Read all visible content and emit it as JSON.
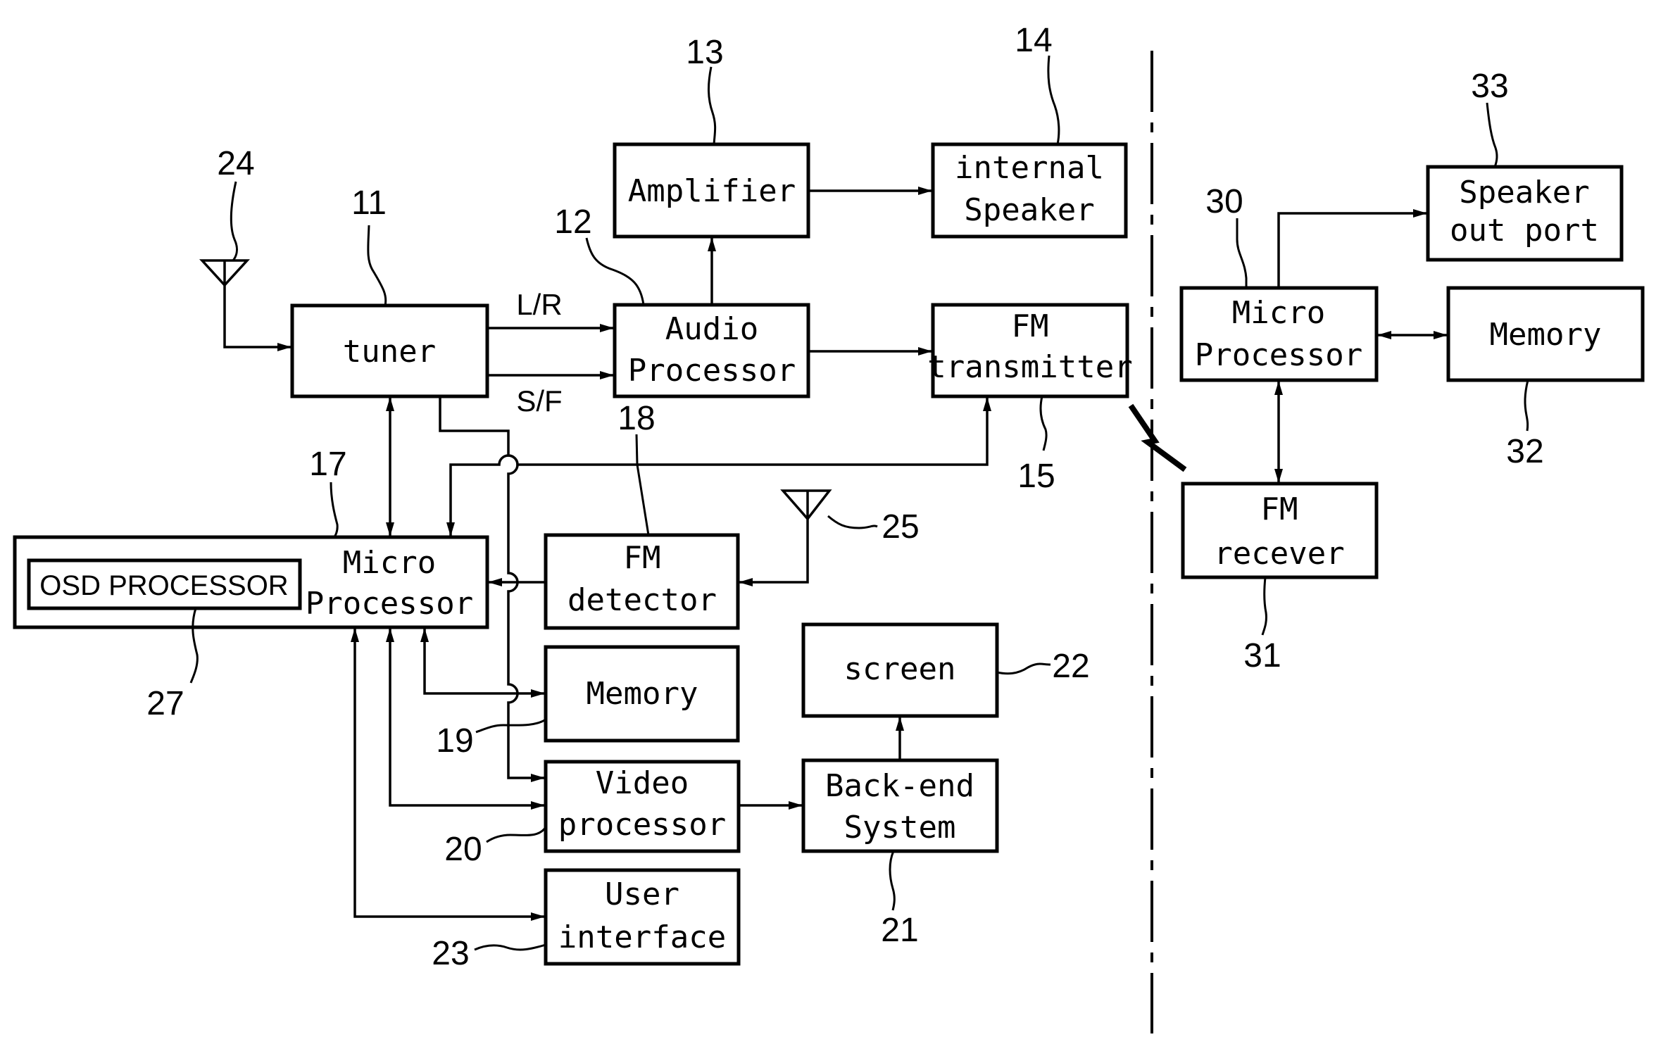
{
  "diagram": {
    "type": "block-diagram",
    "boundary": "dash-dot-vertical-divider",
    "blocks": {
      "tuner": {
        "ref": "11",
        "lines": [
          "tuner"
        ]
      },
      "audio_proc": {
        "ref": "12",
        "lines": [
          "Audio",
          "Processor"
        ]
      },
      "amplifier": {
        "ref": "13",
        "lines": [
          "Amplifier"
        ]
      },
      "int_speaker": {
        "ref": "14",
        "lines": [
          "internal",
          "Speaker"
        ]
      },
      "fm_tx": {
        "ref": "15",
        "lines": [
          "FM",
          "transmitter"
        ]
      },
      "micro17": {
        "ref": "17",
        "lines": [
          "Micro",
          "Processor"
        ]
      },
      "osd": {
        "ref": "27",
        "lines": [
          "OSD PROCESSOR"
        ]
      },
      "fm_det": {
        "ref": "18",
        "lines": [
          "FM",
          "detector"
        ]
      },
      "memory19": {
        "ref": "19",
        "lines": [
          "Memory"
        ]
      },
      "video": {
        "ref": "20",
        "lines": [
          "Video",
          "processor"
        ]
      },
      "backend": {
        "ref": "21",
        "lines": [
          "Back-end",
          "System"
        ]
      },
      "screen": {
        "ref": "22",
        "lines": [
          "screen"
        ]
      },
      "ui": {
        "ref": "23",
        "lines": [
          "User",
          "interface"
        ]
      },
      "micro30": {
        "ref": "30",
        "lines": [
          "Micro",
          "Processor"
        ]
      },
      "fm_rx": {
        "ref": "31",
        "lines": [
          "FM",
          "recever"
        ]
      },
      "memory32": {
        "ref": "32",
        "lines": [
          "Memory"
        ]
      },
      "spk_port": {
        "ref": "33",
        "lines": [
          "Speaker",
          "out port"
        ]
      }
    },
    "antennas": {
      "antenna24": {
        "ref": "24"
      },
      "antenna25": {
        "ref": "25"
      }
    },
    "signal_labels": {
      "lr": "L/R",
      "sf": "S/F"
    },
    "connections": [
      {
        "from": "antenna24",
        "to": "tuner",
        "direction": "one-way"
      },
      {
        "from": "tuner",
        "to": "audio_proc",
        "label": "L/R",
        "direction": "one-way"
      },
      {
        "from": "tuner",
        "to": "audio_proc",
        "label": "S/F",
        "direction": "one-way"
      },
      {
        "from": "audio_proc",
        "to": "amplifier",
        "direction": "one-way"
      },
      {
        "from": "amplifier",
        "to": "int_speaker",
        "direction": "one-way"
      },
      {
        "from": "audio_proc",
        "to": "fm_tx",
        "direction": "one-way"
      },
      {
        "from": "tuner",
        "to": "micro17",
        "direction": "two-way"
      },
      {
        "from": "micro17",
        "to": "fm_tx",
        "direction": "two-way"
      },
      {
        "from": "fm_det",
        "to": "micro17",
        "direction": "one-way"
      },
      {
        "from": "antenna25",
        "to": "fm_det",
        "direction": "one-way"
      },
      {
        "from": "micro17",
        "to": "memory19",
        "direction": "two-way"
      },
      {
        "from": "tuner",
        "to": "video",
        "direction": "one-way"
      },
      {
        "from": "micro17",
        "to": "video",
        "direction": "two-way"
      },
      {
        "from": "micro17",
        "to": "ui",
        "direction": "two-way"
      },
      {
        "from": "video",
        "to": "backend",
        "direction": "one-way"
      },
      {
        "from": "backend",
        "to": "screen",
        "direction": "one-way"
      },
      {
        "from": "fm_tx",
        "to": "fm_rx",
        "direction": "wireless"
      },
      {
        "from": "micro30",
        "to": "spk_port",
        "direction": "one-way"
      },
      {
        "from": "micro30",
        "to": "memory32",
        "direction": "two-way"
      },
      {
        "from": "micro30",
        "to": "fm_rx",
        "direction": "two-way"
      }
    ]
  }
}
